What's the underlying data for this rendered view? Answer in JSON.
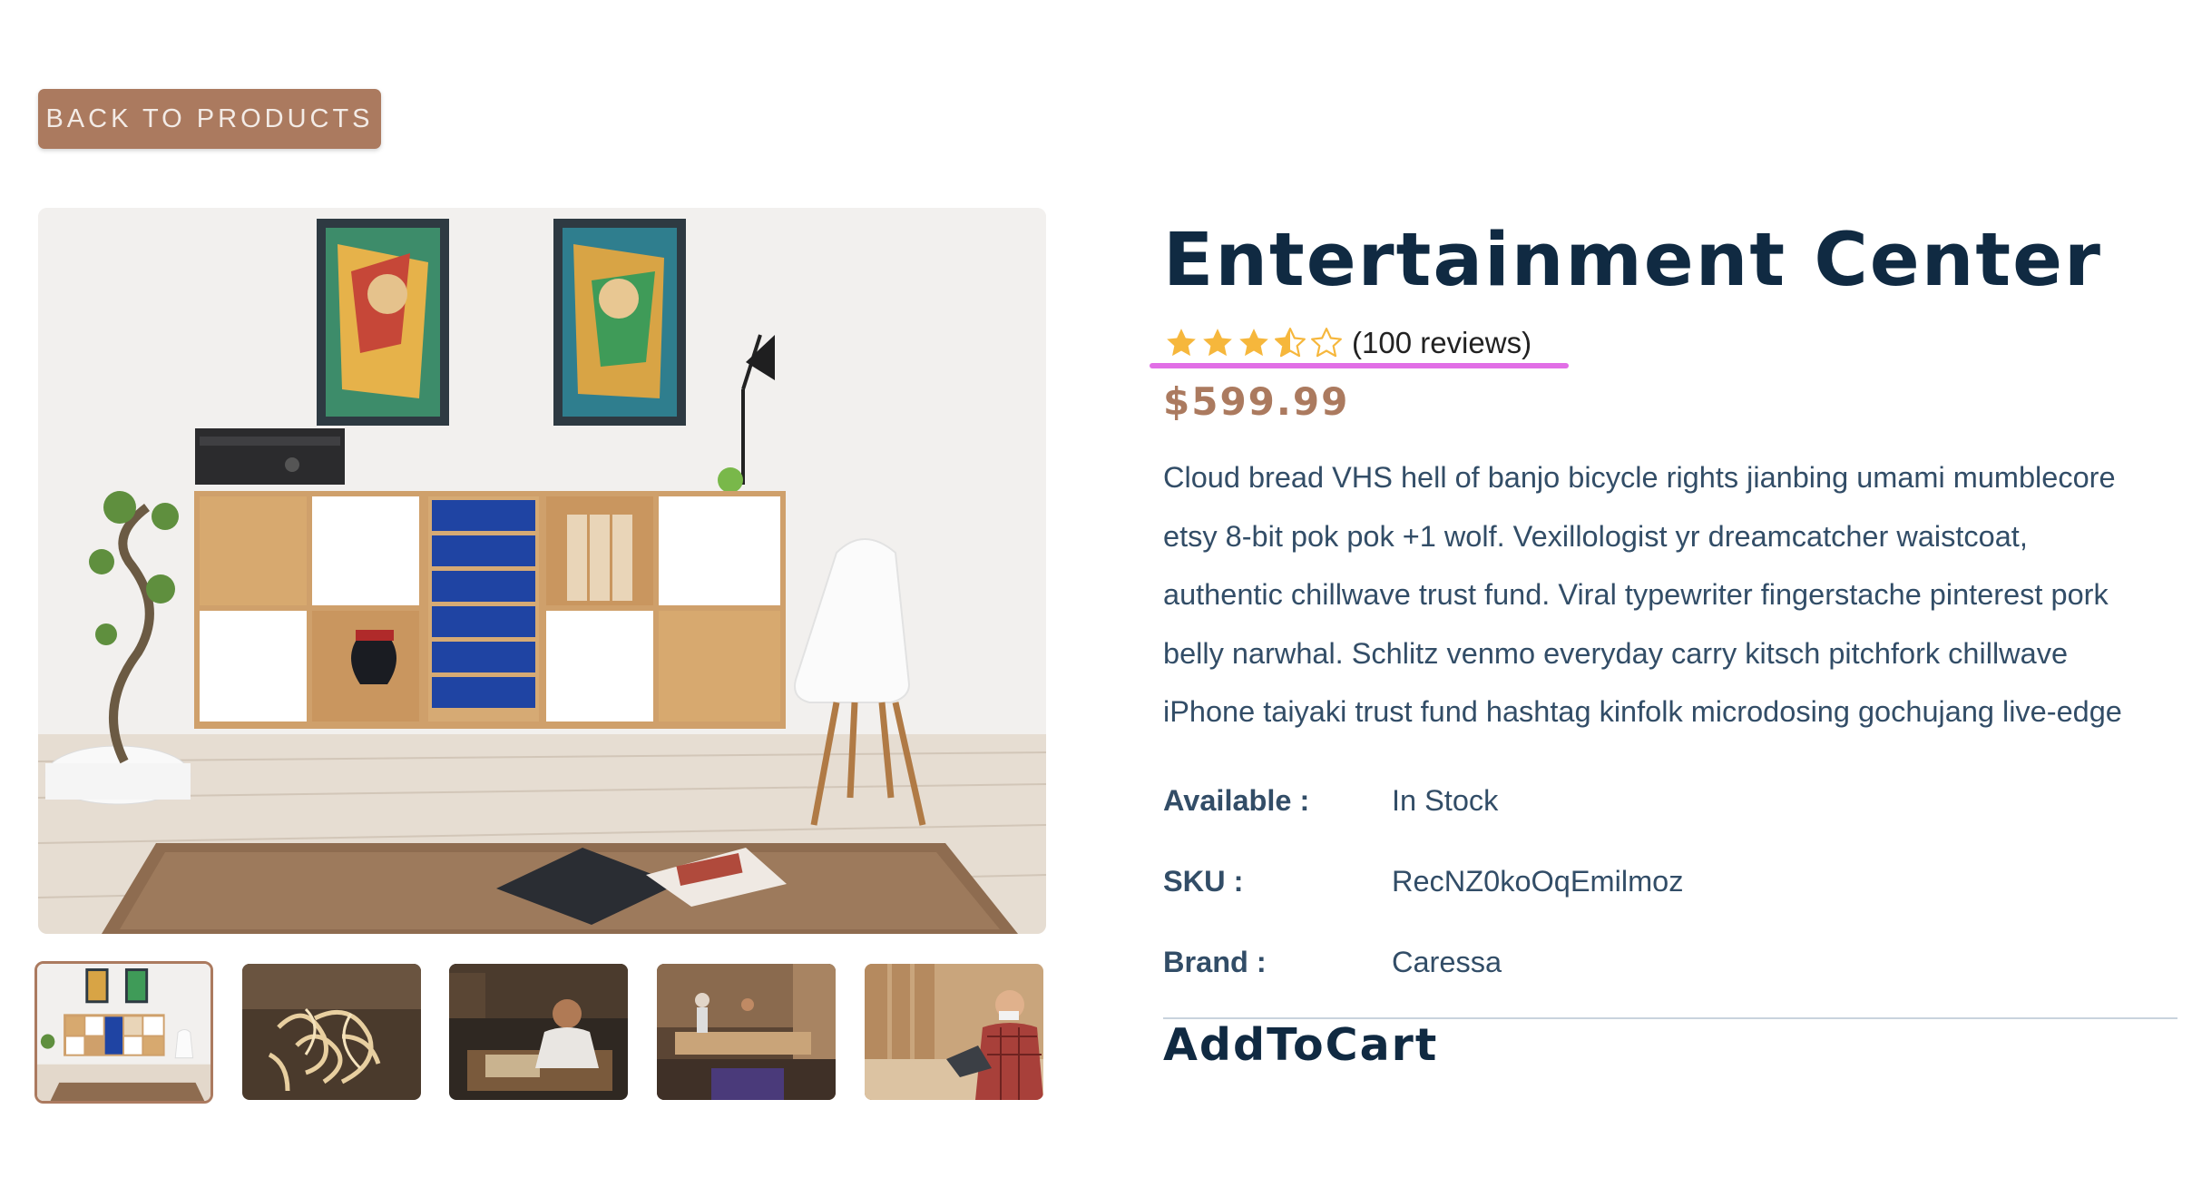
{
  "back_button": {
    "label": "back to products"
  },
  "gallery": {
    "main_image": "entertainment-center-room-photo",
    "thumbnails": [
      {
        "name": "entertainment-center-room-photo",
        "active": true
      },
      {
        "name": "wood-shavings-photo",
        "active": false
      },
      {
        "name": "carpenter-at-workbench-photo",
        "active": false
      },
      {
        "name": "woodshop-workers-photo",
        "active": false
      },
      {
        "name": "craftsman-with-laptop-photo",
        "active": false
      }
    ]
  },
  "product": {
    "title": "Entertainment Center",
    "rating": 3.5,
    "rating_max": 5,
    "reviews_text": "(100 reviews)",
    "price": "$599.99",
    "description_lines": [
      "Cloud bread VHS hell of banjo bicycle rights jianbing umami mumblecore",
      "etsy 8-bit pok pok +1 wolf. Vexillologist yr dreamcatcher waistcoat,",
      "authentic chillwave trust fund. Viral typewriter fingerstache pinterest pork",
      "belly narwhal. Schlitz venmo everyday carry kitsch pitchfork chillwave",
      "iPhone taiyaki trust fund hashtag kinfolk microdosing gochujang live-edge"
    ],
    "info": {
      "available_label": "Available :",
      "available_value": "In Stock",
      "sku_label": "SKU :",
      "sku_value": "RecNZ0koOqEmilmoz",
      "brand_label": "Brand :",
      "brand_value": "Caressa"
    },
    "add_to_cart": "AddToCart"
  },
  "colors": {
    "accent": "#ab7a5f",
    "title": "#102a42",
    "body_text": "#324d67",
    "star": "#f6b73c",
    "rating_underline": "#e16ee6"
  },
  "icons": {
    "star_full": "star-full-icon",
    "star_half": "star-half-icon",
    "star_empty": "star-empty-icon"
  }
}
